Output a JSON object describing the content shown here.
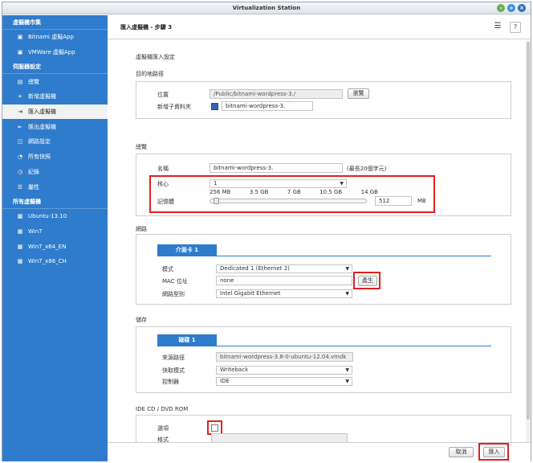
{
  "window": {
    "title": "Virtualization Station",
    "controls": [
      "minimize-icon",
      "maximize-icon",
      "close-icon"
    ]
  },
  "sidebar": {
    "sections": [
      {
        "title": "虛擬機市集",
        "items": [
          {
            "label": "Bitnami 虛擬App",
            "icon": "package-icon"
          },
          {
            "label": "VMWare 虛擬App",
            "icon": "package-icon"
          }
        ]
      },
      {
        "title": "伺服器設定",
        "items": [
          {
            "label": "總覽",
            "icon": "overview-icon"
          },
          {
            "label": "新增虛擬機",
            "icon": "plus-icon"
          },
          {
            "label": "匯入虛擬機",
            "icon": "import-icon",
            "active": true
          },
          {
            "label": "匯出虛擬機",
            "icon": "export-icon"
          },
          {
            "label": "網路設定",
            "icon": "network-icon"
          },
          {
            "label": "所有快照",
            "icon": "snapshot-icon"
          },
          {
            "label": "紀錄",
            "icon": "log-icon"
          },
          {
            "label": "屬性",
            "icon": "properties-icon"
          }
        ]
      },
      {
        "title": "所有虛擬機",
        "items": [
          {
            "label": "Ubuntu-13.10",
            "icon": "vm-icon"
          },
          {
            "label": "Win7",
            "icon": "vm-icon"
          },
          {
            "label": "Win7_x64_EN",
            "icon": "vm-icon"
          },
          {
            "label": "Win7_x86_CH",
            "icon": "vm-icon"
          }
        ]
      }
    ]
  },
  "header": {
    "title": "匯入虛擬機 - 步驟 3",
    "help_label": "?"
  },
  "form": {
    "title": "虛擬機匯入設定",
    "destination": {
      "section_label": "目的地路徑",
      "location_label": "位置",
      "location_value": "/Public/bitnami-wordpress-3./",
      "browse_label": "瀏覽",
      "new_folder_label": "新增子資料夾",
      "new_folder_value": "bitnami-wordpress-3."
    },
    "overview": {
      "section_label": "總覽",
      "name_label": "名稱",
      "name_value": "bitnami-wordpress-3.",
      "name_hint": "(最長20個字元)",
      "cores_label": "核心",
      "cores_value": "1",
      "memory_label": "記憶體",
      "memory_ticks": [
        "256 MB",
        "3.5 GB",
        "7 GB",
        "10.5 GB",
        "14 GB"
      ],
      "memory_value": "512",
      "memory_unit": "MB",
      "memory_fraction": 0.02
    },
    "network": {
      "section_label": "網路",
      "tab_label": "介面卡 1",
      "mode_label": "模式",
      "mode_value": "Dedicated 1 (Ethernet 2)",
      "mac_label": "MAC 位址",
      "mac_value": "none",
      "generate_label": "產生",
      "model_label": "網路型別",
      "model_value": "Intel Gigabit Ethernet"
    },
    "storage": {
      "section_label": "儲存",
      "tab_label": "磁碟 1",
      "source_label": "來源路徑",
      "source_value": "bitnami-wordpress-3.8-0-ubuntu-12.04.vmdk",
      "cache_label": "快取模式",
      "cache_value": "Writeback",
      "controller_label": "控制器",
      "controller_value": "IDE"
    },
    "cdrom": {
      "section_label": "IDE CD / DVD ROM",
      "option_label": "選項",
      "format_label": "格式",
      "format_value": ""
    }
  },
  "footer": {
    "cancel_label": "取消",
    "import_label": "匯入"
  },
  "colors": {
    "sidebar": "#2f7ccc",
    "highlight": "#e02020",
    "tab_header": "#2f7ccc"
  }
}
